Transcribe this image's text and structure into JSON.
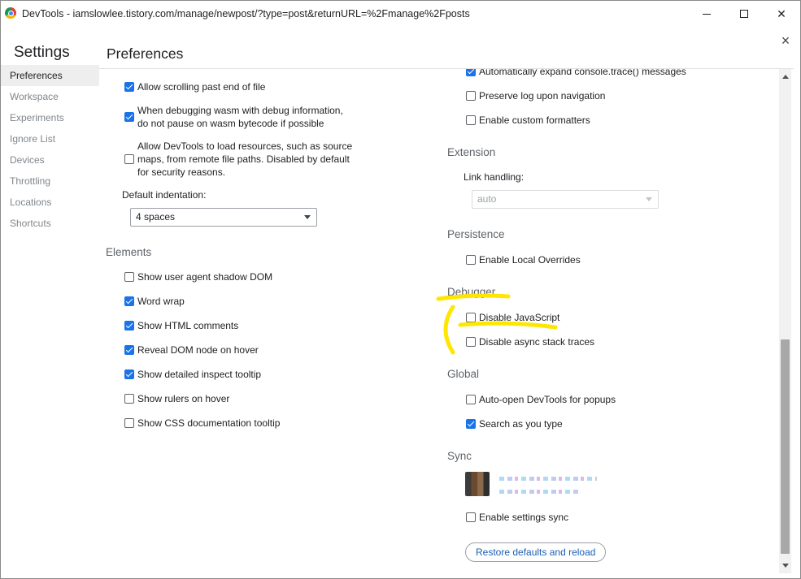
{
  "window": {
    "title": "DevTools - iamslowlee.tistory.com/manage/newpost/?type=post&returnURL=%2Fmanage%2Fposts",
    "minimize_glyph": "",
    "close_glyph": "✕"
  },
  "settings": {
    "heading": "Settings",
    "pane_title": "Preferences",
    "close_glyph": "×"
  },
  "sidebar": {
    "items": [
      {
        "label": "Preferences",
        "active": true
      },
      {
        "label": "Workspace"
      },
      {
        "label": "Experiments"
      },
      {
        "label": "Ignore List"
      },
      {
        "label": "Devices"
      },
      {
        "label": "Throttling"
      },
      {
        "label": "Locations"
      },
      {
        "label": "Shortcuts"
      }
    ]
  },
  "sources": {
    "allow_scrolling": {
      "label": "Allow scrolling past end of file",
      "checked": true
    },
    "wasm_debug": {
      "label_line1": "When debugging wasm with debug information,",
      "label_line2": "do not pause on wasm bytecode if possible",
      "checked": true
    },
    "remote_files": {
      "label_line1": "Allow DevTools to load resources, such as source",
      "label_line2": "maps, from remote file paths. Disabled by default",
      "label_line3": "for security reasons.",
      "checked": false
    },
    "indentation_label": "Default indentation:",
    "indentation_value": "4 spaces"
  },
  "elements": {
    "title": "Elements",
    "items": [
      {
        "label": "Show user agent shadow DOM",
        "checked": false
      },
      {
        "label": "Word wrap",
        "checked": true
      },
      {
        "label": "Show HTML comments",
        "checked": true
      },
      {
        "label": "Reveal DOM node on hover",
        "checked": true
      },
      {
        "label": "Show detailed inspect tooltip",
        "checked": true
      },
      {
        "label": "Show rulers on hover",
        "checked": false
      },
      {
        "label": "Show CSS documentation tooltip",
        "checked": false
      }
    ]
  },
  "console": {
    "items": [
      {
        "label": "Automatically expand console.trace() messages",
        "checked": true
      },
      {
        "label": "Preserve log upon navigation",
        "checked": false
      },
      {
        "label": "Enable custom formatters",
        "checked": false
      }
    ]
  },
  "extension": {
    "title": "Extension",
    "link_handling_label": "Link handling:",
    "link_handling_value": "auto"
  },
  "persistence": {
    "title": "Persistence",
    "items": [
      {
        "label": "Enable Local Overrides",
        "checked": false
      }
    ]
  },
  "debugger": {
    "title": "Debugger",
    "items": [
      {
        "label": "Disable JavaScript",
        "checked": false
      },
      {
        "label": "Disable async stack traces",
        "checked": false
      }
    ]
  },
  "global": {
    "title": "Global",
    "items": [
      {
        "label": "Auto-open DevTools for popups",
        "checked": false
      },
      {
        "label": "Search as you type",
        "checked": true
      }
    ]
  },
  "sync": {
    "title": "Sync",
    "items": [
      {
        "label": "Enable settings sync",
        "checked": false
      }
    ]
  },
  "restore_button": "Restore defaults and reload",
  "colors": {
    "accent": "#1a73e8",
    "highlighter": "#ffe600"
  }
}
